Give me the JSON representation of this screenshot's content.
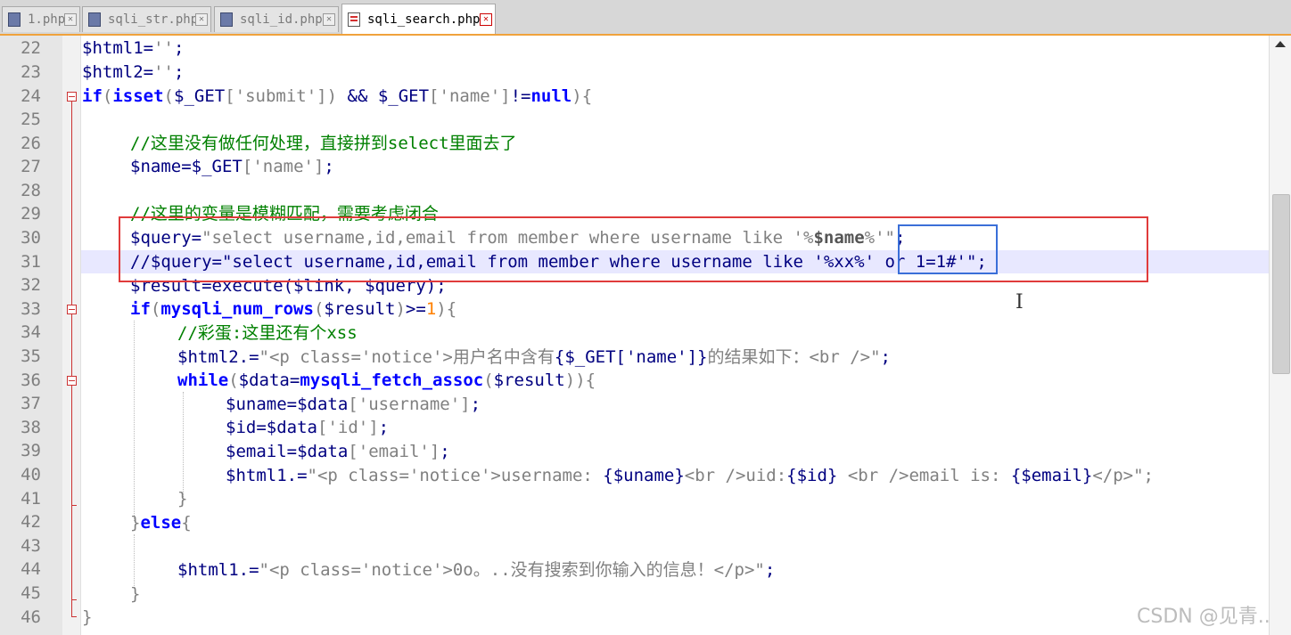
{
  "tabs": [
    {
      "label": "1.php",
      "active": false
    },
    {
      "label": "sqli_str.php",
      "active": false
    },
    {
      "label": "sqli_id.php",
      "active": false
    },
    {
      "label": "sqli_search.php",
      "active": true
    }
  ],
  "tab_close_glyph": "✕",
  "line_numbers": [
    "22",
    "23",
    "24",
    "25",
    "26",
    "27",
    "28",
    "29",
    "30",
    "31",
    "32",
    "33",
    "34",
    "35",
    "36",
    "37",
    "38",
    "39",
    "40",
    "41",
    "42",
    "43",
    "44",
    "45",
    "46"
  ],
  "code": {
    "l22": {
      "var": "$html1",
      "op": "=",
      "str": "''",
      "end": ";"
    },
    "l23": {
      "var": "$html2",
      "op": "=",
      "str": "''",
      "end": ";"
    },
    "l24": {
      "if": "if",
      "p1": "(",
      "isset": "isset",
      "p2": "(",
      "get1": "$_GET",
      "b1": "[",
      "key1": "'submit'",
      "b2": "]",
      "p3": ")",
      "and": " && ",
      "get2": "$_GET",
      "b3": "[",
      "key2": "'name'",
      "b4": "]",
      "ne": "!=",
      "null": "null",
      "p4": ")",
      "brace": "{"
    },
    "l26": {
      "comment": "//这里没有做任何处理，直接拼到select里面去了"
    },
    "l27": {
      "var": "$name",
      "op": "=",
      "get": "$_GET",
      "b1": "[",
      "key": "'name'",
      "b2": "]",
      "end": ";"
    },
    "l29": {
      "comment": "//这里的变量是模糊匹配，需要考虑闭合"
    },
    "l30": {
      "var": "$query",
      "op": "=",
      "str1": "\"select username,id,email from member where username like '%",
      "bvar": "$name",
      "str2": "%'\"",
      "end": ";"
    },
    "l31": {
      "comment": "//$query=\"select username,id,email from member where username like '%xx%' or 1=1#'\";"
    },
    "l32": {
      "var": "$result",
      "op": "=",
      "fn": "execute",
      "args": "($link, $query)",
      "end": ";"
    },
    "l33": {
      "if": "if",
      "p1": "(",
      "fn": "mysqli_num_rows",
      "p2": "(",
      "arg": "$result",
      "p3": ")",
      "op": ">=",
      "num": "1",
      "p4": ")",
      "brace": "{"
    },
    "l34": {
      "comment": "//彩蛋:这里还有个xss"
    },
    "l35": {
      "var": "$html2",
      "op": ".=",
      "str1": "\"<p class='notice'>用户名中含有",
      "bvar": "{$_GET['name']}",
      "str2": "的结果如下：<br />\"",
      "end": ";"
    },
    "l36": {
      "kw": "while",
      "p1": "(",
      "var": "$data",
      "op": "=",
      "fn": "mysqli_fetch_assoc",
      "p2": "(",
      "arg": "$result",
      "p3": ")",
      "p4": ")",
      "brace": "{"
    },
    "l37": {
      "var": "$uname",
      "op": "=",
      "var2": "$data",
      "b1": "[",
      "key": "'username'",
      "b2": "]",
      "end": ";"
    },
    "l38": {
      "var": "$id",
      "op": "=",
      "var2": "$data",
      "b1": "[",
      "key": "'id'",
      "b2": "]",
      "end": ";"
    },
    "l39": {
      "var": "$email",
      "op": "=",
      "var2": "$data",
      "b1": "[",
      "key": "'email'",
      "b2": "]",
      "end": ";"
    },
    "l40": {
      "var": "$html1",
      "op": ".=",
      "s1": "\"<p class='notice'>username: ",
      "v1": "{$uname}",
      "s2": "<br />uid:",
      "v2": "{$id}",
      "s3": " <br />email is: ",
      "v3": "{$email}",
      "s4": "</p>\";"
    },
    "l41": {
      "brace": "}"
    },
    "l42": {
      "brace1": "}",
      "kw": "else",
      "brace2": "{"
    },
    "l44": {
      "var": "$html1",
      "op": ".=",
      "str": "\"<p class='notice'>0o。..没有搜索到你输入的信息！</p>\"",
      "end": ";"
    },
    "l45": {
      "brace": "}"
    },
    "l46": {
      "brace": "}"
    }
  },
  "watermark": "CSDN @见青.."
}
